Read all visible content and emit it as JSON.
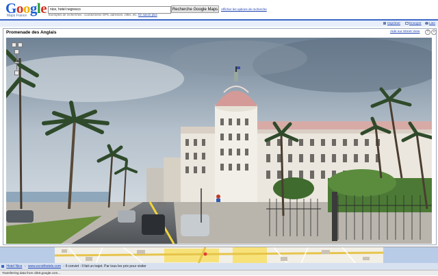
{
  "logo": {
    "letters": [
      {
        "char": "G",
        "color": "#1a5ed4"
      },
      {
        "char": "o",
        "color": "#d8301f"
      },
      {
        "char": "o",
        "color": "#f0b400"
      },
      {
        "char": "g",
        "color": "#1a5ed4"
      },
      {
        "char": "l",
        "color": "#239a2e"
      },
      {
        "char": "e",
        "color": "#d8301f"
      }
    ],
    "subtitle": "Maps France"
  },
  "search": {
    "value": "nice, hotel negresco",
    "button_label": "Recherche Google Maps",
    "options_link": "Afficher les options de recherche",
    "hint": "Exemples de recherches : coordonnées GPS, adresses, villes, etc.",
    "hint_example": "En savoir plus"
  },
  "toolbar": {
    "print": "Imprimer",
    "send": "Envoyer",
    "link": "Lien"
  },
  "panel": {
    "title": "Promenade des Anglais",
    "streetview_link": "Aide sur Street View",
    "icons": [
      "?",
      "×"
    ]
  },
  "footer": {
    "hotel_link": "Hotel Nice",
    "url": "www.ecrsithotels.com",
    "text": "- Il conviet : Il fait un trajet. Par tous les prix pour visiter"
  },
  "status": "Transferring data from cbk0.google.com..."
}
